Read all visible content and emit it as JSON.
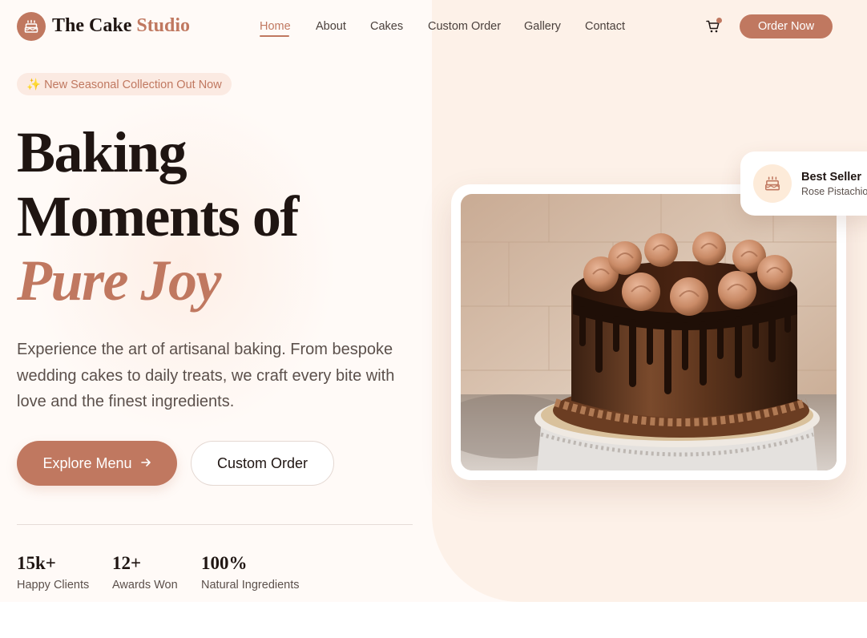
{
  "brand": {
    "name_main": "The Cake",
    "name_accent": "Studio",
    "logo_icon": "cake-icon"
  },
  "nav": {
    "links": [
      {
        "label": "Home",
        "active": true
      },
      {
        "label": "About"
      },
      {
        "label": "Cakes"
      },
      {
        "label": "Custom Order"
      },
      {
        "label": "Gallery"
      },
      {
        "label": "Contact"
      }
    ],
    "cart_icon": "cart-icon",
    "order_button": "Order Now"
  },
  "hero": {
    "badge": "✨ New Seasonal Collection Out Now",
    "headline": {
      "line1": "Baking",
      "line2": "Moments of",
      "line3": "Pure Joy"
    },
    "description": "Experience the art of artisanal baking. From bespoke wedding cakes to daily treats, we craft every bite with love and the finest ingredients.",
    "primary_button": "Explore Menu",
    "primary_button_icon": "arrow-right-icon",
    "secondary_button": "Custom Order",
    "stats": [
      {
        "value": "15k+",
        "label": "Happy Clients"
      },
      {
        "value": "12+",
        "label": "Awards Won"
      },
      {
        "value": "100%",
        "label": "Natural Ingredients"
      }
    ]
  },
  "feature": {
    "image_subject": "chocolate drip cake with piped swirls on a cake stand",
    "bestseller_title": "Best Seller",
    "bestseller_subtitle": "Rose Pistachio",
    "bestseller_icon": "cake-icon"
  },
  "colors": {
    "accent": "#c07860",
    "dark": "#1f1512",
    "hero_bg": "#fffaf7",
    "panel_bg": "#fdf1e8"
  }
}
